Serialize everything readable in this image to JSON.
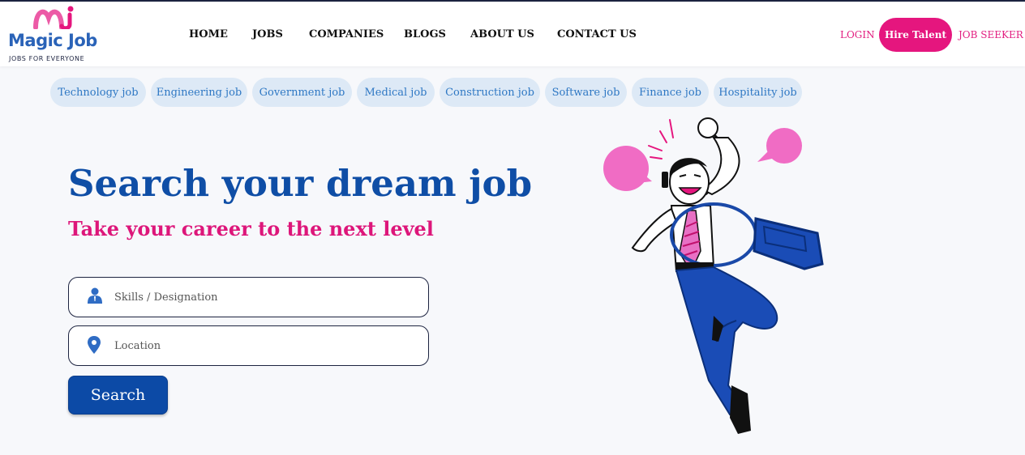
{
  "brand": {
    "name": "Magic Job",
    "tagline": "JOBS FOR EVERYONE",
    "colors": {
      "blue": "#2a63b8",
      "pink": "#e5167e",
      "dark_navy": "#1c2340"
    }
  },
  "nav": {
    "items": [
      {
        "label": "HOME"
      },
      {
        "label": "JOBS"
      },
      {
        "label": "COMPANIES"
      },
      {
        "label": "BLOGS"
      },
      {
        "label": "ABOUT US"
      },
      {
        "label": "CONTACT US"
      }
    ],
    "login_label": "LOGIN",
    "hire_label": "Hire Talent",
    "seeker_label": "JOB SEEKER"
  },
  "categories": [
    {
      "label": "Technology job"
    },
    {
      "label": "Engineering job"
    },
    {
      "label": "Government job"
    },
    {
      "label": "Medical job"
    },
    {
      "label": "Construction job"
    },
    {
      "label": "Software job"
    },
    {
      "label": "Finance job"
    },
    {
      "label": "Hospitality job"
    }
  ],
  "hero": {
    "title": "Search your dream job",
    "subtitle": "Take your career to the next level"
  },
  "search": {
    "skills_placeholder": "Skills / Designation",
    "skills_value": "",
    "skills_icon": "user-icon",
    "location_placeholder": "Location",
    "location_value": "",
    "location_icon": "map-pin-icon",
    "button_label": "Search"
  },
  "illustration": {
    "icon": "jumping-businessman-illustration"
  }
}
